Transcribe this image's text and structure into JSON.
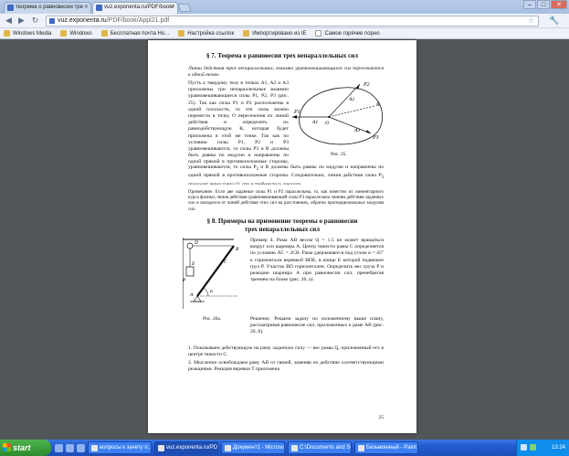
{
  "browser": {
    "tabs": [
      {
        "title": "теорема о равновесии тре"
      },
      {
        "title": "vuz.exponenta.ru/PDF/book/"
      }
    ],
    "url_host": "vuz.exponenta.ru",
    "url_path": "/PDF/book/Appl21.pdf",
    "window_buttons": {
      "minimize": "–",
      "maximize": "□",
      "close": "✕"
    }
  },
  "bookmarks": [
    {
      "label": "Windows Media",
      "icon": "folder-icon"
    },
    {
      "label": "Windows",
      "icon": "folder-icon"
    },
    {
      "label": "Бесплатная почта Ho...",
      "icon": "folder-icon"
    },
    {
      "label": "Настройка ссылок",
      "icon": "folder-icon"
    },
    {
      "label": "Импортировано из IE",
      "icon": "folder-icon"
    },
    {
      "label": "Самое горячее порно",
      "icon": "page-icon"
    }
  ],
  "pdf": {
    "sec7_title": "§ 7. Теорема о равновесии трех непараллельных сил",
    "theorem": "Линии действия трех непараллельных, взаимно уравновешивающихся сил пересекаются в одной точке.",
    "proof_text": "Пусть к твердому телу в точках A1, A2 и A3 приложены три непараллельные взаимно уравновешивающиеся силы P1, P2, P3 (рис. 25). Так как силы P1 и P2 расположены в одной плоскости, то эти силы можно перенести в точку O пересечения их линий действия и определить их равнодействующую R, которая будет приложена в этой же точке. Так как по условию силы P1, P2 и P3 уравновешиваются, то силы P3 и R должны быть равны по модулю и направлены по одной прямой в противоположные стороны. Следовательно, линия действия силы P3 проходит через точку O, что и требовалось доказать.",
    "fig25_caption": "Рис. 25.",
    "note": "Примечание. Если две заданные силы P1 и P2 параллельны, то, как известно из элементарного курса физики, линия действия уравновешивающей силы P3 параллельна линиям действия заданных сил и находится от линий действия этих сил на расстояниях, обратно пропорциональных модулям сил.",
    "sec8_title_1": "§ 8. Примеры на применение теоремы о равновесии",
    "sec8_title_2": "трех непараллельных сил",
    "example_text": "Пример 4. Рама AB весом Q = 1.5 кн может вращаться вокруг оси шарнира A. Центр тяжести рамы C определяется по условию AC = 2CB. Рама удерживается под углом α = 45° к горизонтали веревкой BDE, в конце E которой подвешен груз P. Участок BD горизонтален. Определить вес груза P и реакцию шарнира A при равновесии сил, пренебрегая трением на блоке (рис. 26, а).",
    "solution_text": "Решение. Решаем задачу по изложенному выше плану, рассматривая равновесие сил, приложенных к раме AB (рис. 26, б).",
    "fig26_caption": "Рис. 26а.",
    "step1": "1. Показываем действующую на раму заданную силу — вес рамы Q, приложенный его в центре тяжести C.",
    "step2": "2. Мысленно освобождаем раму AB от связей, заменяя их действие соответствующими реакциями. Реакция веревки T приложена",
    "page_number": "25",
    "fig25_labels": {
      "P1": "P1",
      "P2": "P2",
      "P3": "P3",
      "A1": "A1",
      "A2": "A2",
      "A3": "A3",
      "O": "O",
      "R": "R"
    },
    "fig26_labels": {
      "D": "D",
      "E": "E",
      "B": "B",
      "C": "C",
      "A": "A",
      "P": "P",
      "alpha": "α"
    }
  },
  "taskbar": {
    "start": "start",
    "tasks": [
      {
        "label": "вопросы к зачету п..."
      },
      {
        "label": "vuz.exponenta.ru/PD..."
      },
      {
        "label": "Документ1 - Microso..."
      },
      {
        "label": "C:\\Documents and Se..."
      },
      {
        "label": "Безымянный - Paint"
      }
    ],
    "clock": "13:24"
  }
}
